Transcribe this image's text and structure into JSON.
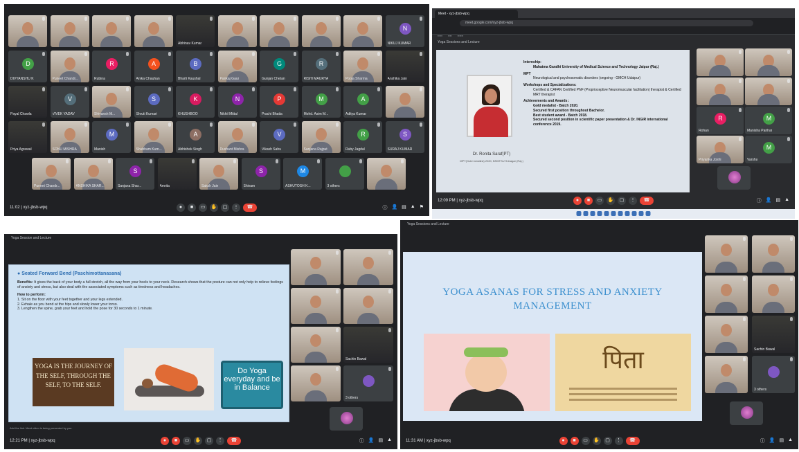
{
  "panel1": {
    "time": "11:02 | xyz-jbsb-wpq",
    "tiles_row1": [
      {
        "name": "",
        "kind": "cam"
      },
      {
        "name": "",
        "kind": "cam"
      },
      {
        "name": "",
        "kind": "cam"
      },
      {
        "name": "",
        "kind": "cam"
      },
      {
        "name": "Abhinav Kumar",
        "kind": "dark"
      },
      {
        "name": "",
        "kind": "cam"
      },
      {
        "name": "",
        "kind": "cam"
      },
      {
        "name": "",
        "kind": "cam"
      },
      {
        "name": "",
        "kind": "cam"
      },
      {
        "name": "NIKUJ KUMAR",
        "initial": "N",
        "color": "#7e57c2"
      }
    ],
    "tiles_row2": [
      {
        "name": "DIVYANSHU K",
        "initial": "D",
        "color": "#43a047"
      },
      {
        "name": "Puneet Chandr...",
        "kind": "cam"
      },
      {
        "name": "Rubina",
        "initial": "R",
        "color": "#e91e63"
      },
      {
        "name": "Anika Chauhan",
        "initial": "A",
        "color": "#f4511e"
      },
      {
        "name": "Bharti Kaushal",
        "initial": "B",
        "color": "#5c6bc0"
      },
      {
        "name": "Pankaj Gaur",
        "kind": "cam"
      },
      {
        "name": "Gunjan Chetan",
        "initial": "G",
        "color": "#00897b"
      },
      {
        "name": "RISHI MAURYA",
        "initial": "R",
        "color": "#546e7a"
      },
      {
        "name": "Pooja Sharma",
        "kind": "cam"
      },
      {
        "name": "Anshika Jain",
        "kind": "dark"
      }
    ],
    "tiles_row3": [
      {
        "name": "Payal Chawla",
        "kind": "dark"
      },
      {
        "name": "VIVEK YADAV",
        "initial": "V",
        "color": "#546e7a"
      },
      {
        "name": "Shivansh M...",
        "kind": "cam"
      },
      {
        "name": "Shruti Kumari",
        "initial": "S",
        "color": "#5c6bc0"
      },
      {
        "name": "KHUSHBOO",
        "initial": "K",
        "color": "#d81b60"
      },
      {
        "name": "Nikhil Mittal",
        "initial": "N",
        "color": "#8e24aa"
      },
      {
        "name": "Prachi Bhatia",
        "initial": "P",
        "color": "#e53935"
      },
      {
        "name": "Mohd. Asim M...",
        "initial": "M",
        "color": "#43a047"
      },
      {
        "name": "Aditya Kumar",
        "initial": "A",
        "color": "#43a047"
      },
      {
        "name": "",
        "kind": "cam"
      }
    ],
    "tiles_row4": [
      {
        "name": "Priya Agrawal",
        "kind": "dark"
      },
      {
        "name": "SONU MISHRA",
        "kind": "cam"
      },
      {
        "name": "Manish",
        "initial": "M",
        "color": "#5c6bc0"
      },
      {
        "name": "Shubham Kum...",
        "kind": "cam"
      },
      {
        "name": "Abhishek Singh",
        "initial": "A",
        "color": "#8d6e63"
      },
      {
        "name": "Dushant Mishra",
        "kind": "cam"
      },
      {
        "name": "Vikash Sahu",
        "initial": "V",
        "color": "#5c6bc0"
      },
      {
        "name": "Sanjana Rajput",
        "kind": "cam"
      },
      {
        "name": "Ruby Jagdal",
        "initial": "R",
        "color": "#43a047"
      },
      {
        "name": "SURAJ KUMAR",
        "initial": "S",
        "color": "#7e57c2"
      }
    ],
    "tiles_row5": [
      {
        "name": "Puneet Chandr...",
        "kind": "cam"
      },
      {
        "name": "ANSHIKA SHAR...",
        "kind": "cam"
      },
      {
        "name": "Sanjana Shar...",
        "initial": "S",
        "color": "#8e24aa"
      },
      {
        "name": "Amrita",
        "kind": "dark"
      },
      {
        "name": "Saksh Jain",
        "kind": "cam"
      },
      {
        "name": "Shivam",
        "initial": "S",
        "color": "#8e24aa"
      },
      {
        "name": "ASHUTOSH K...",
        "initial": "M",
        "color": "#1e88e5"
      },
      {
        "name": "3 others",
        "initial": "",
        "color": "#43a047"
      },
      {
        "name": "",
        "kind": "cam"
      }
    ]
  },
  "panel2": {
    "tab_title": "Meet - xyz-jbsb-wpq",
    "url": "meet.google.com/xyz-jbsb-wpq",
    "meet_title": "Yoga Sessions and Lecture",
    "person_name": "Dr. Ronita Saraf(PT)",
    "person_sub": "MPT(Gold medalist) 2020, BSMTSU Srinagar (Raj.)",
    "bio": [
      {
        "text": "Internship:",
        "bold": true,
        "indent": false
      },
      {
        "text": "Mahatma Gandhi University of Medical Science and Technology Jaipur (Raj.)",
        "bold": true,
        "indent": true
      },
      {
        "text": "MPT",
        "bold": true,
        "indent": false
      },
      {
        "text": "Neurological and psychosomatic disorders (ongoing - GMCH Udaipur)",
        "bold": false,
        "indent": true
      },
      {
        "text": "Workshops and Specializations:",
        "bold": true,
        "indent": false
      },
      {
        "text": "Certified & CAFAN Certified PNF (Proprioceptive Neuromuscular facilitation) therapist & Certified MRT therapist",
        "bold": false,
        "indent": true
      },
      {
        "text": "Achievements and Awards :",
        "bold": true,
        "indent": false
      },
      {
        "text": "Gold medalist - Batch 2020.",
        "bold": true,
        "indent": true
      },
      {
        "text": "Secured first position throughout Bachelor.",
        "bold": true,
        "indent": true
      },
      {
        "text": "Best student award - Batch 2018.",
        "bold": true,
        "indent": true
      },
      {
        "text": "Secured second position in scientific paper presentation & Dr. INGIR international conference 2019.",
        "bold": true,
        "indent": true
      }
    ],
    "side_tiles": [
      {
        "name": "",
        "kind": "cam"
      },
      {
        "name": "",
        "kind": "cam"
      },
      {
        "name": "",
        "kind": "cam"
      },
      {
        "name": "",
        "kind": "cam"
      },
      {
        "name": "Rohan",
        "initial": "R",
        "color": "#e91e63"
      },
      {
        "name": "Manisha Parihar",
        "initial": "M",
        "color": "#43a047"
      },
      {
        "name": "Priyanka Joshi",
        "kind": "cam"
      },
      {
        "name": "Varsha",
        "initial": "M",
        "color": "#43a047"
      }
    ],
    "self_label": "You",
    "time": "12:09 PM | xyz-jbsb-wpq"
  },
  "panel3": {
    "meet_title": "Yoga Session and Lecture",
    "slide_title": "Seated Forward Bend (Paschimottanasana)",
    "benefits_label": "Benefits:",
    "benefits_text": "It gives the back of your body a full stretch, all the way from your heels to your neck. Research shows that the posture can not only help to relieve feelings of anxiety and stress, but also deal with the associated symptoms such as tiredness and headaches.",
    "how_label": "How to perform:",
    "steps": [
      "1. Sit on the floor with your feet together and your legs extended.",
      "2. Exhale as you bend at the hips and slowly lower your torso.",
      "3. Lengthen the spine, grab your feet and hold the pose for 30 seconds to 1 minute."
    ],
    "quote": "YOGA IS THE JOURNEY OF THE SELF, THROUGH THE SELF, TO THE SELF.",
    "do_yoga": "Do Yoga everyday and be in Balance",
    "caption": "Add the link. Meet video is being presented by you.",
    "time": "12:21 PM | xyz-jbsb-wpq",
    "side_tiles": [
      {
        "name": "",
        "kind": "cam"
      },
      {
        "name": "",
        "kind": "cam"
      },
      {
        "name": "",
        "kind": "cam"
      },
      {
        "name": "",
        "kind": "cam"
      },
      {
        "name": "",
        "kind": "cam"
      },
      {
        "name": "Sachin Bawal",
        "kind": "dark"
      },
      {
        "name": "",
        "kind": "cam"
      },
      {
        "name": "3 others",
        "initial": "",
        "color": "#7e57c2"
      }
    ],
    "self_label": "You"
  },
  "panel4": {
    "meet_title": "Yoga Sessions and Lecture",
    "slide_title": "YOGA ASANAS FOR STRESS AND ANXIETY MANAGEMENT",
    "sign_glyph": "पिता",
    "time": "11:31 AM | xyz-jbsb-wpq",
    "side_tiles": [
      {
        "name": "",
        "kind": "cam"
      },
      {
        "name": "",
        "kind": "cam"
      },
      {
        "name": "",
        "kind": "cam"
      },
      {
        "name": "",
        "kind": "cam"
      },
      {
        "name": "",
        "kind": "cam"
      },
      {
        "name": "Sachin Bawal",
        "kind": "dark"
      },
      {
        "name": "",
        "kind": "cam"
      },
      {
        "name": "3 others",
        "initial": "",
        "color": "#7e57c2"
      }
    ],
    "self_label": "You"
  },
  "colors": {
    "end_call": "#ea4335",
    "meet_bg": "#202124",
    "tile_bg": "#3c4043",
    "slide_title": "#3b8fce"
  },
  "icons": [
    "mic-icon",
    "camera-icon",
    "captions-icon",
    "raise-hand-icon",
    "present-icon",
    "more-icon",
    "end-call-icon",
    "info-icon",
    "people-icon",
    "chat-icon",
    "activities-icon"
  ]
}
